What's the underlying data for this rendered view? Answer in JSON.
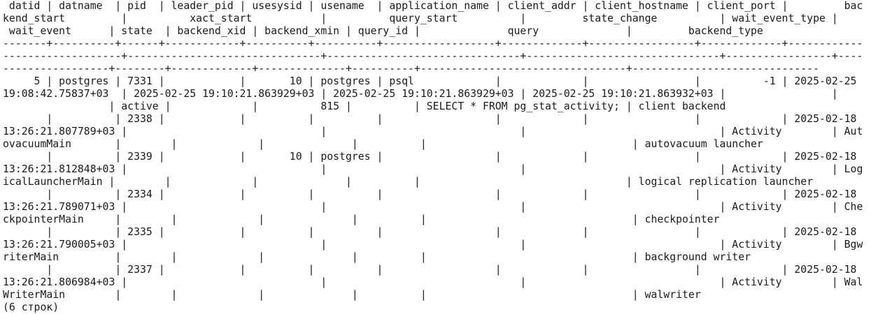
{
  "terminal": {
    "lines": [
      " datid | datname  | pid  | leader_pid | usesysid | usename  | application_name | client_addr | client_hostname | client_port |         bac",
      "kend_start         |          xact_start           |          query_start          |         state_change          | wait_event_type |",
      " wait_event      | state  | backend_xid | backend_xmin | query_id |              query              |         backend_type",
      "-------+----------+------+------------+----------+----------+------------------+-------------+-----------------+-------------+------------",
      "-------------------+-------------------------------+-------------------------------+-------------------------------+-----------------+----",
      "-----------------+--------+-------------+--------------+----------+---------------------------------+------------------------------",
      "     5 | postgres | 7331 |            |       10 | postgres | psql             |             |                 |          -1 | 2025-02-25",
      "19:08:42.75837+03  | 2025-02-25 19:10:21.863929+03 | 2025-02-25 19:10:21.863929+03 | 2025-02-25 19:10:21.863932+03 |                 |",
      "                 | active |             |          815 |          | SELECT * FROM pg_stat_activity; | client backend",
      "       |          | 2338 |            |          |          |                  |             |                 |             | 2025-02-18",
      "13:26:21.807789+03 |                               |                               |                               | Activity        | Aut",
      "ovacuumMain       |        |             |              |          |                                 | autovacuum launcher",
      "       |          | 2339 |            |       10 | postgres |                  |             |                 |             | 2025-02-18",
      "13:26:21.812848+03 |                               |                               |                               | Activity        | Log",
      "icalLauncherMain |        |             |              |          |                                 | logical replication launcher",
      "       |          | 2334 |            |          |          |                  |             |                 |             | 2025-02-18",
      "13:26:21.789071+03 |                               |                               |                               | Activity        | Che",
      "ckpointerMain     |        |             |              |          |                                 | checkpointer",
      "       |          | 2335 |            |          |          |                  |             |                 |             | 2025-02-18",
      "13:26:21.790005+03 |                               |                               |                               | Activity        | Bgw",
      "riterMain         |        |             |              |          |                                 | background writer",
      "       |          | 2337 |            |          |          |                  |             |                 |             | 2025-02-18",
      "13:26:21.806984+03 |                               |                               |                               | Activity        | Wal",
      "WriterMain        |        |             |              |          |                                 | walwriter",
      "(6 строк)"
    ]
  }
}
